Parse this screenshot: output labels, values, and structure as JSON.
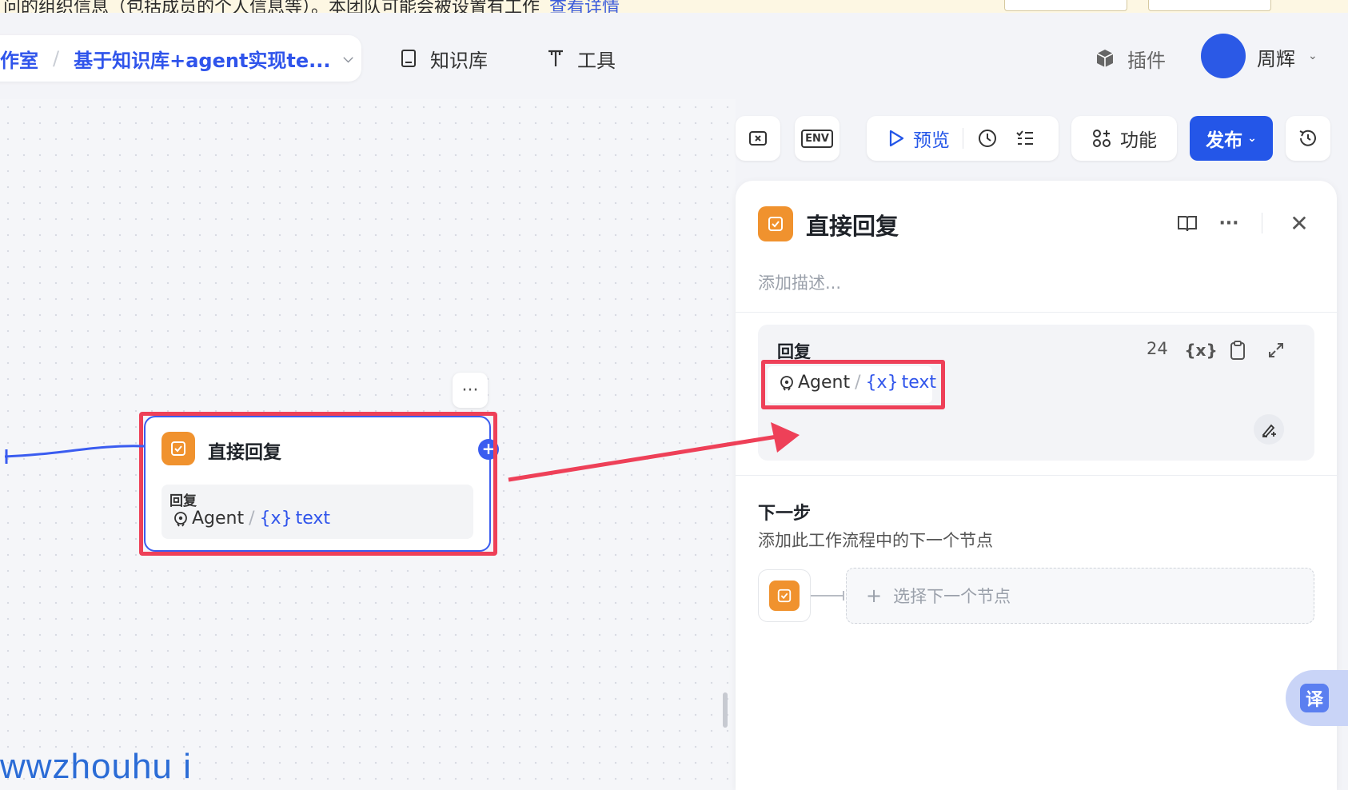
{
  "banner": {
    "text": "问的组织信息（包括成员的个人信息等）。本团队可能会被设置有工作",
    "link": "查看详情"
  },
  "breadcrumb": {
    "workspace": "作室",
    "project": "基于知识库+agent实现te..."
  },
  "nav": {
    "knowledge": "知识库",
    "tools": "工具",
    "plugins": "插件"
  },
  "user": {
    "name": "周辉"
  },
  "toolbar": {
    "preview": "预览",
    "features": "功能",
    "publish": "发布",
    "env_label": "ENV"
  },
  "node": {
    "title": "直接回复",
    "body_label": "回复",
    "var_source": "Agent",
    "var_name": "text",
    "var_prefix": "{x}",
    "menu": "···"
  },
  "panel": {
    "title": "直接回复",
    "description_placeholder": "添加描述...",
    "reply_label": "回复",
    "reply_count": "24",
    "var_source": "Agent",
    "var_name": "text",
    "var_prefix": "{x}",
    "next_title": "下一步",
    "next_desc": "添加此工作流程中的下一个节点",
    "next_select": "选择下一个节点"
  },
  "translate": {
    "label": "译"
  },
  "watermark": "wwzhouhu i",
  "colors": {
    "accent": "#2456e8",
    "node_orange": "#f0922e",
    "highlight_red": "#ee4058"
  }
}
